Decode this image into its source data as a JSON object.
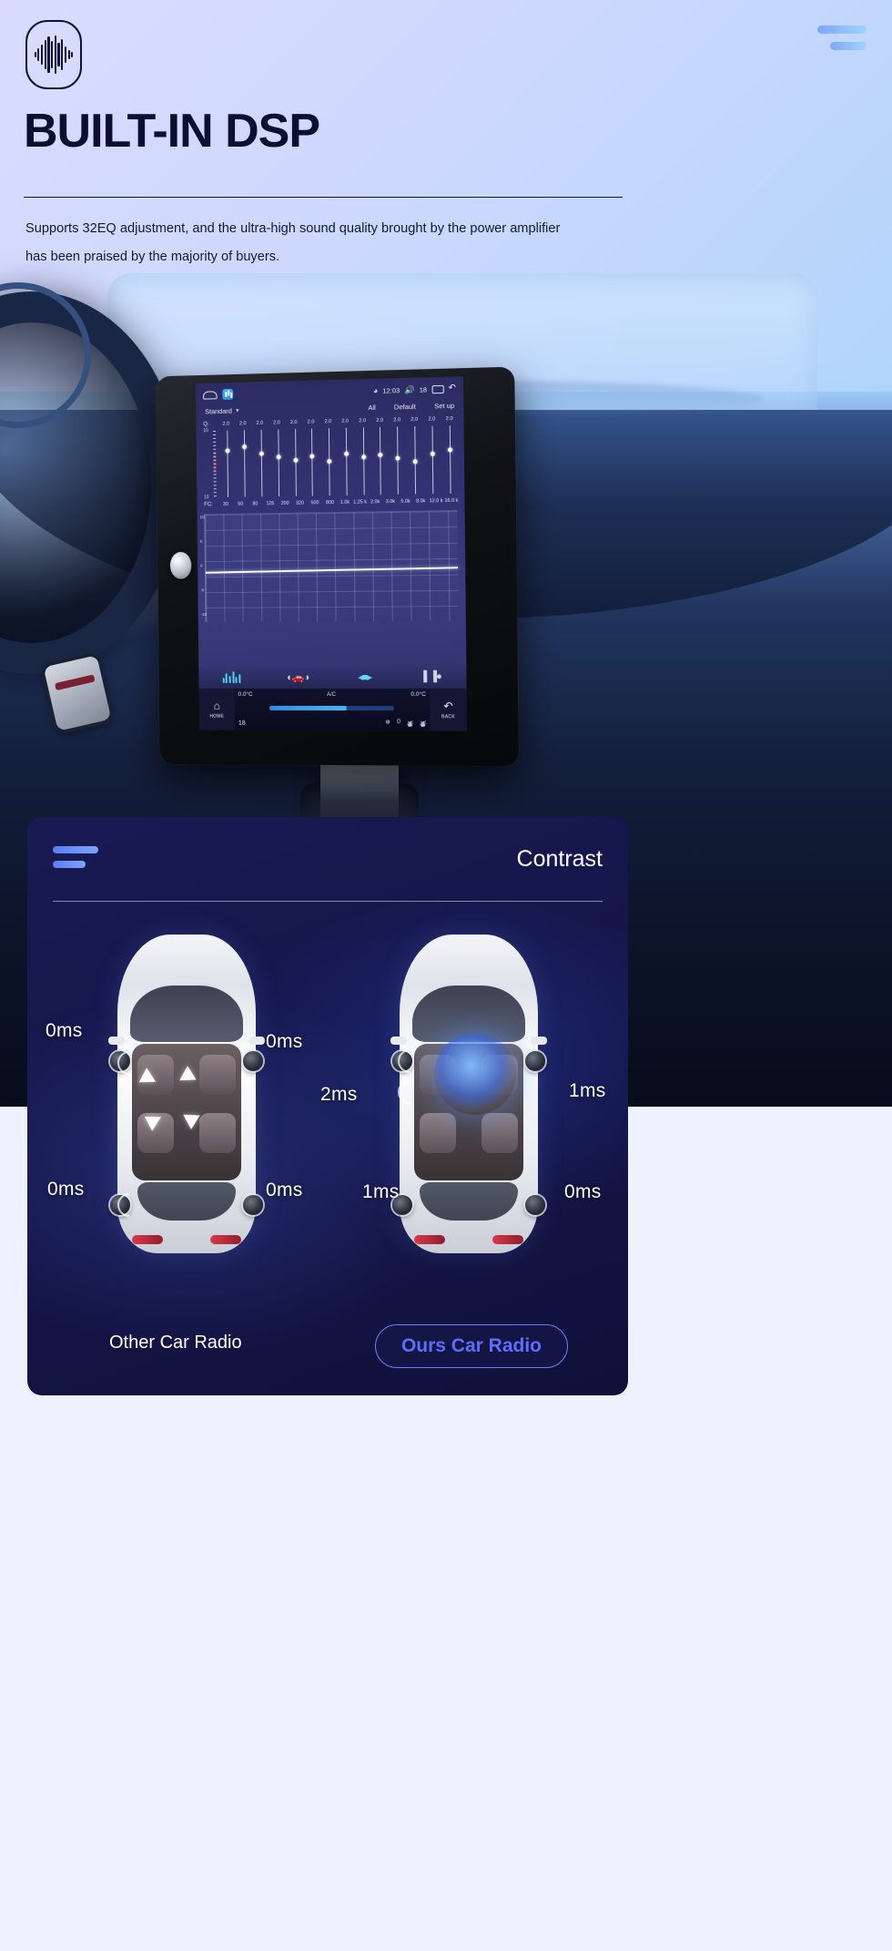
{
  "hero": {
    "logo_icon": "audio-waveform-icon",
    "menu_icon": "menu-lines-icon",
    "title": "BUILT-IN DSP",
    "description": "Supports 32EQ adjustment, and the ultra-high sound quality brought by the power amplifier has been praised by the majority of buyers."
  },
  "radio_screen": {
    "status_bar": {
      "home_icon": "home-icon",
      "app_icon": "equalizer-app-icon",
      "signal_icon": "wifi-icon",
      "time": "12:03",
      "volume_icon": "volume-icon",
      "volume_value": "18",
      "sdcard_icon": "sdcard-icon",
      "back_icon": "back-arrow-icon"
    },
    "eq": {
      "preset": "Standard",
      "preset_caret": "chevron-down-icon",
      "tab_all": "All",
      "tab_default": "Default",
      "tab_setup": "Set up",
      "q_label": "Q:",
      "q_values": [
        "2.0",
        "2.0",
        "2.0",
        "2.0",
        "2.0",
        "2.0",
        "2.0",
        "2.0",
        "2.0",
        "2.0",
        "2.0",
        "2.0",
        "2.0",
        "2.0"
      ],
      "scale_top": "10",
      "scale_bottom": "10",
      "fc_label": "FC:",
      "fc_values": [
        "30",
        "50",
        "80",
        "125",
        "200",
        "320",
        "500",
        "800",
        "1.0k",
        "1.25 k",
        "2.0k",
        "3.0k",
        "5.0k",
        "8.0k",
        "12.0 k",
        "16.0 k"
      ],
      "graph_labels": [
        "10",
        "5",
        "0",
        "-5",
        "-10"
      ],
      "band_positions": [
        22,
        18,
        26,
        30,
        34,
        30,
        36,
        28,
        32,
        30,
        34,
        38,
        30,
        26
      ]
    },
    "functions": {
      "eq_icon": "equalizer-icon",
      "position_icon": "sound-position-icon",
      "balance_icon": "balance-icon",
      "level_icon": "level-meter-icon"
    },
    "climate": {
      "home_button": "HOME",
      "home_icon": "home-icon",
      "temp_left": "0.0°C",
      "temp_right": "0.0°C",
      "ac_label": "A/C",
      "fan_value": "18",
      "defrost_value": "0",
      "defrost_icon": "defrost-icon",
      "seat_icons": [
        "seat-heat-icon",
        "seat-heat-icon",
        "seat-heat-icon",
        "seat-heat-icon"
      ],
      "back_button": "BACK",
      "back_icon": "back-arrow-icon"
    }
  },
  "contrast": {
    "menu_icon": "menu-lines-icon",
    "title": "Contrast",
    "left": {
      "caption": "Other Car Radio",
      "labels": [
        "0ms",
        "0ms",
        "0ms",
        "0ms"
      ]
    },
    "right": {
      "caption": "Ours Car Radio",
      "labels": [
        "2ms",
        "1ms",
        "1ms",
        "0ms"
      ]
    },
    "accent_color": "#5f6dff"
  }
}
